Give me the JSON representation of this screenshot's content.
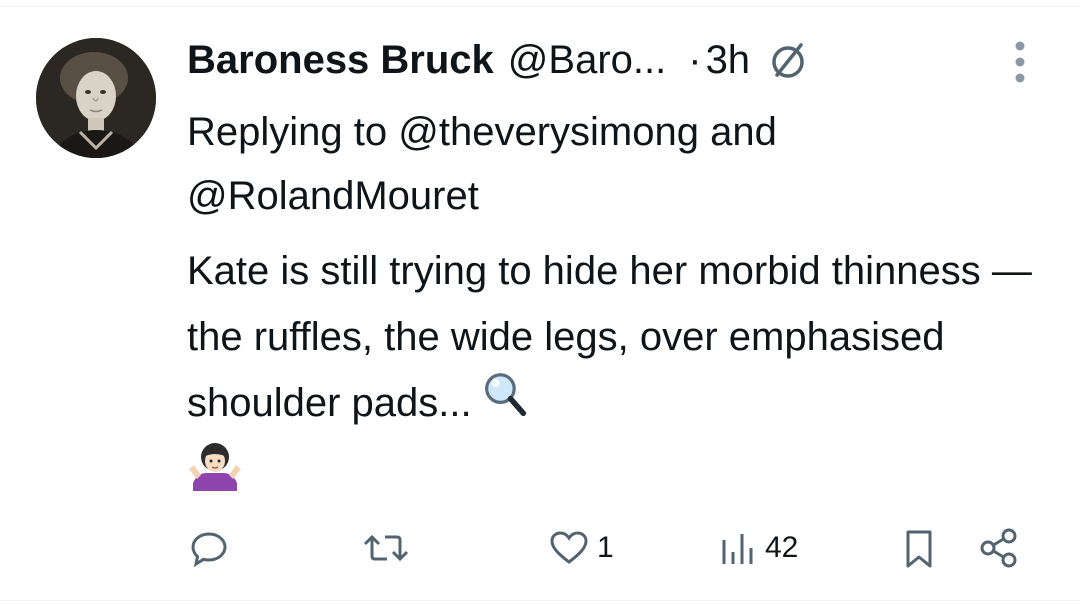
{
  "tweet": {
    "display_name": "Baroness Bruck",
    "handle": "@Baro...",
    "separator": "·",
    "time": "3h",
    "avatar_icon": "portrait-avatar",
    "verified_icon": "no-entry-emblem-icon",
    "more_icon": "more-vertical-icon",
    "reply_prefix": "Replying to",
    "reply_mention_1": "@theverysimong",
    "reply_and": "and",
    "reply_mention_2": "@RolandMouret",
    "text": "Kate is still trying to hide her morbid thinness — the ruffles, the wide legs, over emphasised shoulder pads...",
    "emoji_1": "magnifying-glass-emoji",
    "emoji_2": "shrugging-woman-emoji"
  },
  "actions": {
    "reply_icon": "reply-icon",
    "retweet_icon": "retweet-icon",
    "like_icon": "heart-icon",
    "like_count": "1",
    "views_icon": "views-chart-icon",
    "views_count": "42",
    "bookmark_icon": "bookmark-icon",
    "share_icon": "share-icon"
  },
  "colors": {
    "text": "#0f1419",
    "icon": "#536471",
    "border": "#eff3f4",
    "emoji_purple": "#8e44ad"
  }
}
